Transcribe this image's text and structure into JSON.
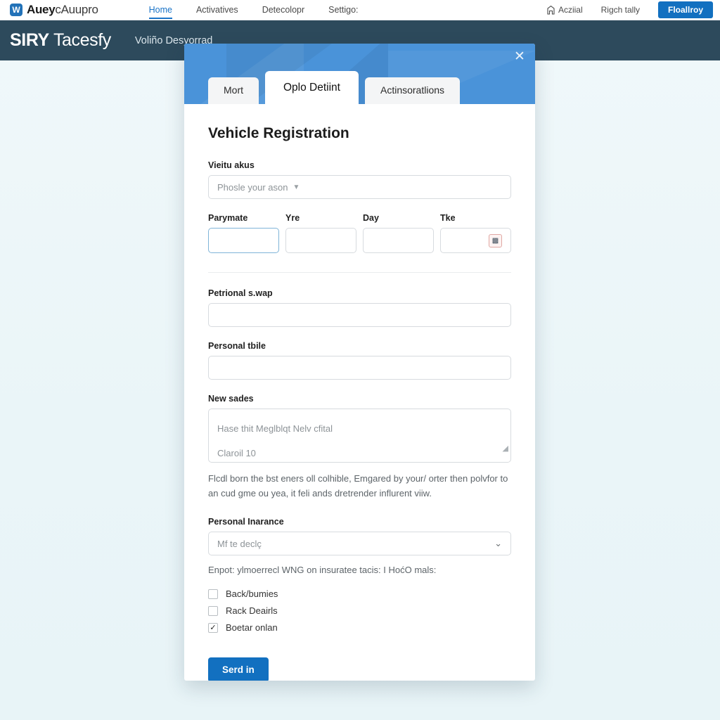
{
  "topnav": {
    "logo_icon": "brand-logo-icon",
    "logo_glyph": "W",
    "brand_bold": "Auey",
    "brand_light": "cAuupro",
    "links": [
      {
        "label": "Home",
        "active": true
      },
      {
        "label": "Activatives",
        "active": false
      },
      {
        "label": "Detecolopr",
        "active": false
      },
      {
        "label": "Settigo:",
        "active": false
      }
    ],
    "right_items": [
      {
        "icon": "bookmark-icon",
        "label": "Acziial"
      },
      {
        "icon": "",
        "label": "Rigch tally"
      }
    ],
    "cta_label": "Floallroy"
  },
  "subheader": {
    "brand_bold": "SIRY",
    "brand_light": "Tacesfy",
    "subtitle": "Voliño Desyorrad"
  },
  "modal": {
    "close_icon": "close-icon",
    "tabs": [
      {
        "label": "Mort",
        "active": false
      },
      {
        "label": "Oplo Detiint",
        "active": true
      },
      {
        "label": "Actinsoratlions",
        "active": false
      }
    ],
    "form": {
      "title": "Vehicle Registration",
      "select_vehicle": {
        "label": "Vieitu akus",
        "placeholder": "Phosle your ason",
        "caret_icon": "chevron-down-icon"
      },
      "date_row": [
        {
          "label": "Parymate",
          "value": "",
          "focused": true,
          "icon": ""
        },
        {
          "label": "Yre",
          "value": "",
          "focused": false,
          "icon": ""
        },
        {
          "label": "Day",
          "value": "",
          "focused": false,
          "icon": ""
        },
        {
          "label": "Tke",
          "value": "",
          "focused": false,
          "icon": "calendar-icon",
          "icon_glyph": "▩"
        }
      ],
      "text_field_1": {
        "label": "Petrional s.wap",
        "value": "",
        "placeholder": ""
      },
      "text_field_2": {
        "label": "Personal tbile",
        "value": "",
        "placeholder": ""
      },
      "notes": {
        "label": "New sades",
        "placeholder_line1": "Hase thit Meglblqt Nelv cfital",
        "placeholder_line2": "Claroil 10",
        "resize_icon": "resize-handle-icon"
      },
      "notes_helper": "Flcdl born the bst eners oll colhible, Emgared by your/ orter then polvfor to an cud gme ou yea, it feli ands dretrender influrent viiw.",
      "insurance": {
        "label": "Personal Inarance",
        "placeholder": "Mf te declç",
        "caret_icon": "chevron-down-icon"
      },
      "insurance_helper": "Enpot: ylmoerrecl WNG on insuratee tacis: I HoćO mals:",
      "checkboxes": [
        {
          "label": "Back/bumies",
          "checked": false
        },
        {
          "label": "Rack Deairls",
          "checked": false
        },
        {
          "label": "Boetar onlan",
          "checked": true,
          "check_glyph": "✓"
        }
      ],
      "submit_label": "Serd in"
    }
  },
  "colors": {
    "page_bg": "#eef7fa",
    "subheader_bg": "#2d4a5c",
    "modal_header_blue": "#4a93d9",
    "accent_blue": "#1270c0",
    "nav_active": "#1a73c7"
  }
}
